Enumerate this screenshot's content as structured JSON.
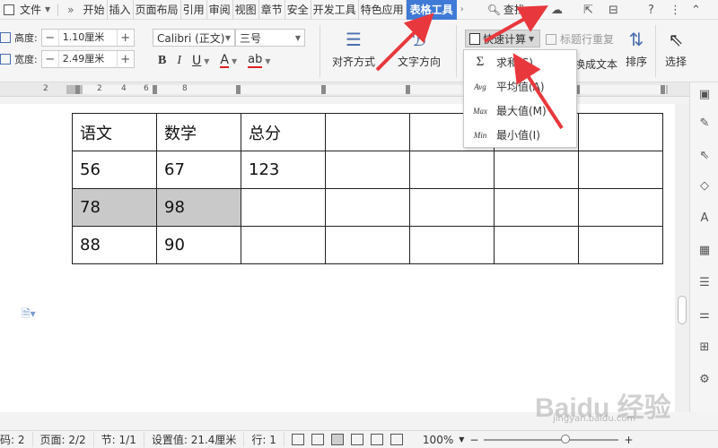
{
  "menubar": {
    "file_label": "文件",
    "more_label": "»",
    "tabs": [
      {
        "label": "开始"
      },
      {
        "label": "插入"
      },
      {
        "label": "页面布局"
      },
      {
        "label": "引用"
      },
      {
        "label": "审阅"
      },
      {
        "label": "视图"
      },
      {
        "label": "章节"
      },
      {
        "label": "安全"
      },
      {
        "label": "开发工具"
      },
      {
        "label": "特色应用"
      },
      {
        "label": "表格工具"
      }
    ],
    "search_label": "查找",
    "help": "?"
  },
  "ribbon": {
    "height_label": "高度:",
    "height_value": "1.10厘米",
    "width_label": "宽度:",
    "width_value": "2.49厘米",
    "spin_minus": "−",
    "spin_plus": "+",
    "font_name": "Calibri (正文)",
    "font_size": "三号",
    "bold": "B",
    "italic": "I",
    "underline": "U",
    "font_color": "A",
    "highlight": "ab",
    "align_label": "对齐方式",
    "text_dir_label": "文字方向",
    "quick_calc_label": "快速计算",
    "title_row_label": "标题行重复",
    "convert_label": "换成文本",
    "sort_label": "排序",
    "select_label": "选择"
  },
  "dropdown": {
    "items": [
      {
        "icon": "Σ",
        "label": "求和(S)"
      },
      {
        "icon": "Avg",
        "label": "平均值(A)"
      },
      {
        "icon": "Max",
        "label": "最大值(M)"
      },
      {
        "icon": "Min",
        "label": "最小值(I)"
      }
    ]
  },
  "ruler": {
    "numbers": [
      "2",
      "2",
      "4",
      "6",
      "8"
    ]
  },
  "table": {
    "rows": [
      [
        "语文",
        "数学",
        "总分",
        "",
        "",
        "",
        ""
      ],
      [
        "56",
        "67",
        "123",
        "",
        "",
        "",
        ""
      ],
      [
        "78",
        "98",
        "",
        "",
        "",
        "",
        ""
      ],
      [
        "88",
        "90",
        "",
        "",
        "",
        "",
        ""
      ]
    ]
  },
  "status": {
    "page_num": "码: 2",
    "pages": "页面: 2/2",
    "section": "节: 1/1",
    "setting": "设置值: 21.4厘米",
    "line": "行: 1",
    "zoom": "100%",
    "zoom_minus": "−",
    "zoom_plus": "+"
  },
  "watermark": {
    "brand": "Baidu 经验",
    "url": "jingyan.baidu.com"
  },
  "colors": {
    "active_tab": "#3f7ad6",
    "arrow": "#e8383d",
    "selected_cell": "#c9c9c9"
  }
}
